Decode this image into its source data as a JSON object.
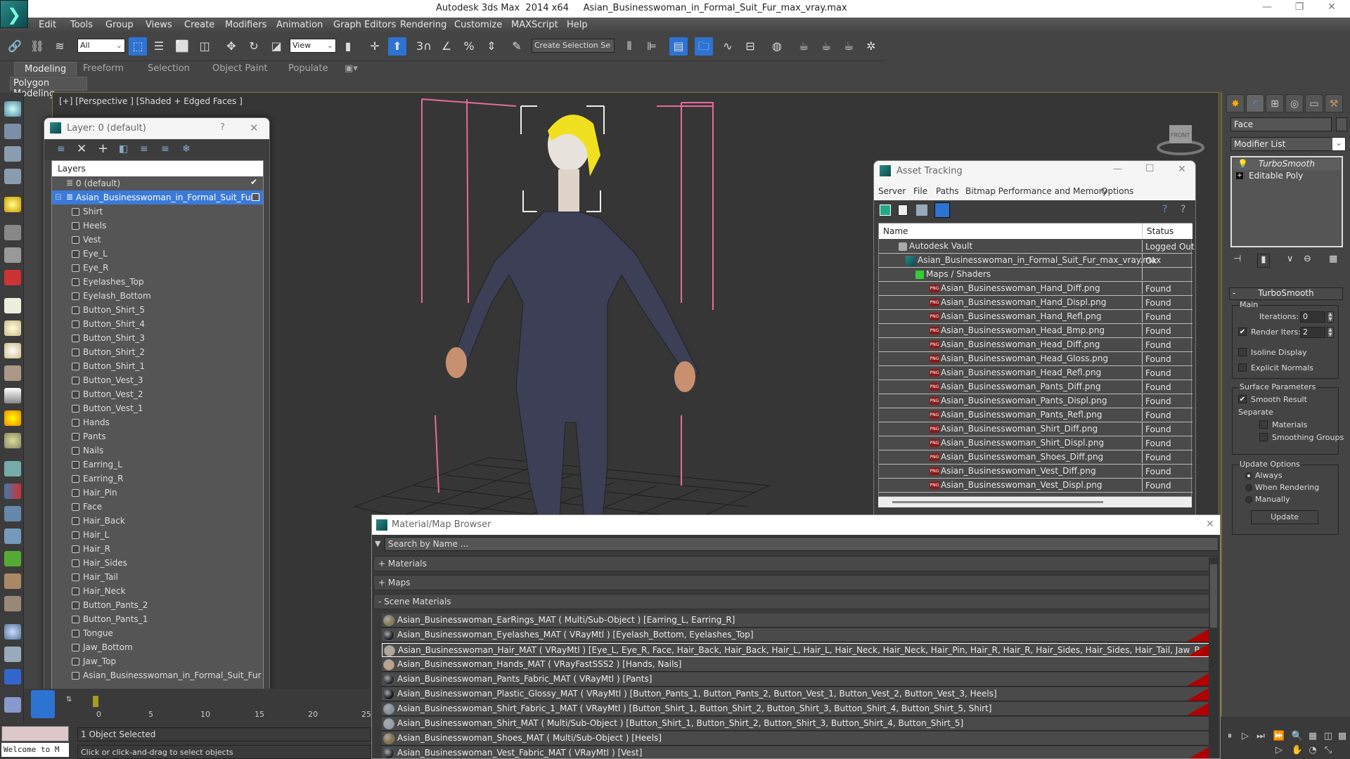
{
  "window": {
    "app_title": "Autodesk 3ds Max  2014 x64",
    "file_title": "Asian_Businesswoman_in_Formal_Suit_Fur_max_vray.max",
    "controls": [
      "minimize",
      "restore",
      "close"
    ]
  },
  "menubar": [
    "Edit",
    "Tools",
    "Group",
    "Views",
    "Create",
    "Modifiers",
    "Animation",
    "Graph Editors",
    "Rendering",
    "Customize",
    "MAXScript",
    "Help"
  ],
  "toolbar": {
    "selection_filter": "All",
    "reference_coord": "View",
    "named_selection_placeholder": "Create Selection Se",
    "snap_labels": [
      "3",
      "%"
    ]
  },
  "ribbon": {
    "tabs": [
      "Modeling",
      "Freeform",
      "Selection",
      "Object Paint",
      "Populate"
    ],
    "active_tab": "Modeling",
    "panel_label": "Polygon Modeling"
  },
  "viewport": {
    "label": "[+] [Perspective ] [Shaded + Edged Faces ]",
    "viewcube_face": "FRONT"
  },
  "layer_dialog": {
    "title": "Layer: 0 (default)",
    "help": "?",
    "header": "Layers",
    "default_layer": "0 (default)",
    "selected_layer": "Asian_Businesswoman_in_Formal_Suit_Fur",
    "objects": [
      "Shirt",
      "Heels",
      "Vest",
      "Eye_L",
      "Eye_R",
      "Eyelashes_Top",
      "Eyelash_Bottom",
      "Button_Shirt_5",
      "Button_Shirt_4",
      "Button_Shirt_3",
      "Button_Shirt_2",
      "Button_Shirt_1",
      "Button_Vest_3",
      "Button_Vest_2",
      "Button_Vest_1",
      "Hands",
      "Pants",
      "Nails",
      "Earring_L",
      "Earring_R",
      "Hair_Pin",
      "Face",
      "Hair_Back",
      "Hair_L",
      "Hair_R",
      "Hair_Sides",
      "Hair_Tail",
      "Hair_Neck",
      "Button_Pants_2",
      "Button_Pants_1",
      "Tongue",
      "Jaw_Bottom",
      "Jaw_Top",
      "Asian_Businesswoman_in_Formal_Suit_Fur"
    ]
  },
  "asset_tracking": {
    "title": "Asset Tracking",
    "menu": [
      "Server",
      "File",
      "Paths",
      "Bitmap Performance and Memory",
      "Options"
    ],
    "columns": [
      "Name",
      "Status"
    ],
    "rows": [
      {
        "name": "Autodesk Vault",
        "status": "Logged Out ...",
        "level": 1,
        "icon": "vault-icon"
      },
      {
        "name": "Asian_Businesswoman_in_Formal_Suit_Fur_max_vray.max",
        "status": "Ok",
        "level": 2,
        "icon": "max-file-icon"
      },
      {
        "name": "Maps / Shaders",
        "status": "",
        "level": 3,
        "icon": "maps-icon"
      },
      {
        "name": "Asian_Businesswoman_Hand_Diff.png",
        "status": "Found",
        "level": 4,
        "icon": "png-icon"
      },
      {
        "name": "Asian_Businesswoman_Hand_Displ.png",
        "status": "Found",
        "level": 4,
        "icon": "png-icon"
      },
      {
        "name": "Asian_Businesswoman_Hand_Refl.png",
        "status": "Found",
        "level": 4,
        "icon": "png-icon"
      },
      {
        "name": "Asian_Businesswoman_Head_Bmp.png",
        "status": "Found",
        "level": 4,
        "icon": "png-icon"
      },
      {
        "name": "Asian_Businesswoman_Head_Diff.png",
        "status": "Found",
        "level": 4,
        "icon": "png-icon"
      },
      {
        "name": "Asian_Businesswoman_Head_Gloss.png",
        "status": "Found",
        "level": 4,
        "icon": "png-icon"
      },
      {
        "name": "Asian_Businesswoman_Head_Refl.png",
        "status": "Found",
        "level": 4,
        "icon": "png-icon"
      },
      {
        "name": "Asian_Businesswoman_Pants_Diff.png",
        "status": "Found",
        "level": 4,
        "icon": "png-icon"
      },
      {
        "name": "Asian_Businesswoman_Pants_Displ.png",
        "status": "Found",
        "level": 4,
        "icon": "png-icon"
      },
      {
        "name": "Asian_Businesswoman_Pants_Refl.png",
        "status": "Found",
        "level": 4,
        "icon": "png-icon"
      },
      {
        "name": "Asian_Businesswoman_Shirt_Diff.png",
        "status": "Found",
        "level": 4,
        "icon": "png-icon"
      },
      {
        "name": "Asian_Businesswoman_Shirt_Displ.png",
        "status": "Found",
        "level": 4,
        "icon": "png-icon"
      },
      {
        "name": "Asian_Businesswoman_Shoes_Diff.png",
        "status": "Found",
        "level": 4,
        "icon": "png-icon"
      },
      {
        "name": "Asian_Businesswoman_Vest_Diff.png",
        "status": "Found",
        "level": 4,
        "icon": "png-icon"
      },
      {
        "name": "Asian_Businesswoman_Vest_Displ.png",
        "status": "Found",
        "level": 4,
        "icon": "png-icon"
      }
    ]
  },
  "material_browser": {
    "title": "Material/Map Browser",
    "search_placeholder": "Search by Name ...",
    "groups": [
      "+ Materials",
      "+ Maps",
      "-  Scene Materials"
    ],
    "materials": [
      {
        "text": "Asian_Businesswoman_EarRings_MAT ( Multi/Sub-Object ) [Earring_L, Earring_R]",
        "swatch": "#8a7a50",
        "flag": false,
        "selected": false
      },
      {
        "text": "Asian_Businesswoman_Eyelashes_MAT ( VRayMtl ) [Eyelash_Bottom, Eyelashes_Top]",
        "swatch": "#222222",
        "flag": true,
        "selected": false
      },
      {
        "text": "Asian_Businesswoman_Hair_MAT ( VRayMtl ) [Eye_L, Eye_R, Face, Hair_Back, Hair_Back, Hair_L, Hair_L, Hair_Neck, Hair_Neck, Hair_Pin, Hair_R, Hair_R, Hair_Sides, Hair_Sides, Hair_Tail, Jaw_Bottom, Jaw_Top, Tongue]",
        "swatch": "#b8a48e",
        "flag": true,
        "selected": true
      },
      {
        "text": "Asian_Businesswoman_Hands_MAT ( VRayFastSSS2 ) [Hands, Nails]",
        "swatch": "#c8a07a",
        "flag": false,
        "selected": false
      },
      {
        "text": "Asian_Businesswoman_Pants_Fabric_MAT ( VRayMtl ) [Pants]",
        "swatch": "#2a2a2a",
        "flag": true,
        "selected": false
      },
      {
        "text": "Asian_Businesswoman_Plastic_Glossy_MAT ( VRayMtl ) [Button_Pants_1, Button_Pants_2, Button_Vest_1, Button_Vest_2, Button_Vest_3, Heels]",
        "swatch": "#1a1a1a",
        "flag": true,
        "selected": false
      },
      {
        "text": "Asian_Businesswoman_Shirt_Fabric_1_MAT ( VRayMtl ) [Button_Shirt_1, Button_Shirt_2, Button_Shirt_3, Button_Shirt_4, Button_Shirt_5, Shirt]",
        "swatch": "#8a8e96",
        "flag": true,
        "selected": false
      },
      {
        "text": "Asian_Businesswoman_Shirt_MAT ( Multi/Sub-Object ) [Button_Shirt_1, Button_Shirt_2, Button_Shirt_3, Button_Shirt_4, Button_Shirt_5]",
        "swatch": "#9a9ea6",
        "flag": false,
        "selected": false
      },
      {
        "text": "Asian_Businesswoman_Shoes_MAT ( Multi/Sub-Object ) [Heels]",
        "swatch": "#8a7040",
        "flag": false,
        "selected": false
      },
      {
        "text": "Asian_Businesswoman_Vest_Fabric_MAT ( VRayMtl ) [Vest]",
        "swatch": "#2a2a2a",
        "flag": true,
        "selected": false
      }
    ]
  },
  "command_panel": {
    "object_name": "Face",
    "modifier_list": "Modifier List",
    "stack": [
      {
        "name": "TurboSmooth",
        "italic": true
      },
      {
        "name": "Editable Poly",
        "italic": false
      }
    ],
    "turbosmooth": {
      "title": "TurboSmooth",
      "main_label": "Main",
      "iterations_label": "Iterations:",
      "iterations": "0",
      "render_iters_label": "Render Iters:",
      "render_iters": "2",
      "render_iters_checked": true,
      "isoline_label": "Isoline Display",
      "isoline_checked": false,
      "explicit_normals_label": "Explicit Normals",
      "explicit_normals_checked": false,
      "surface_label": "Surface Parameters",
      "smooth_result_label": "Smooth Result",
      "smooth_result_checked": true,
      "separate_label": "Separate",
      "materials_label": "Materials",
      "smoothing_groups_label": "Smoothing Groups",
      "update_options_label": "Update Options",
      "always_label": "Always",
      "when_rendering_label": "When Rendering",
      "manually_label": "Manually",
      "update_mode": "Always",
      "update_button": "Update"
    }
  },
  "timeline": {
    "ticks": [
      "0",
      "5",
      "10",
      "15",
      "20",
      "25"
    ],
    "current_frame": 0
  },
  "status": {
    "selection": "1 Object Selected",
    "prompt": "Click or click-and-drag to select objects",
    "maxscript_listener": "Welcome to M"
  },
  "colors": {
    "accent_blue": "#2d73d2",
    "selection_yellow": "#f0e020",
    "bbox_pink": "#e86a9a",
    "missing_flag_red": "#b00000"
  }
}
